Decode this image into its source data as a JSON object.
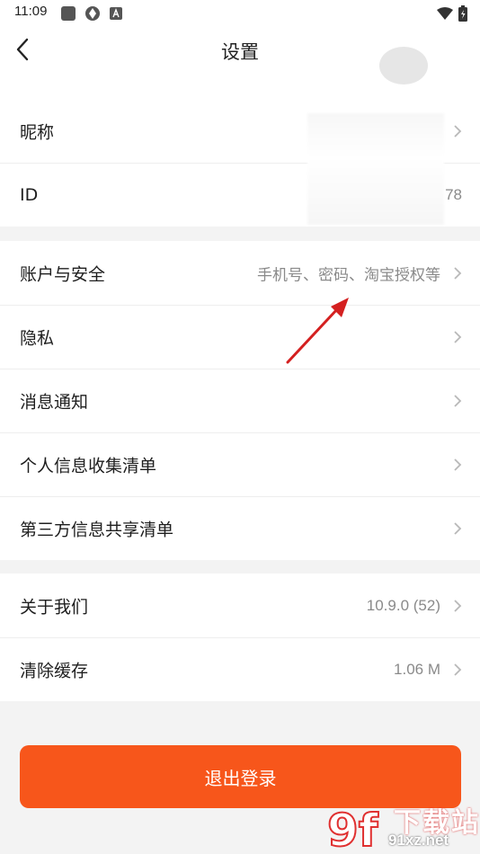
{
  "status_bar": {
    "time": "11:09"
  },
  "header": {
    "title": "设置"
  },
  "profile_rows": [
    {
      "label": "昵称",
      "value": ""
    },
    {
      "label": "ID",
      "value": "78"
    }
  ],
  "security_rows": [
    {
      "label": "账户与安全",
      "value": "手机号、密码、淘宝授权等"
    },
    {
      "label": "隐私",
      "value": ""
    },
    {
      "label": "消息通知",
      "value": ""
    },
    {
      "label": "个人信息收集清单",
      "value": ""
    },
    {
      "label": "第三方信息共享清单",
      "value": ""
    }
  ],
  "about_rows": [
    {
      "label": "关于我们",
      "value": "10.9.0 (52)"
    },
    {
      "label": "清除缓存",
      "value": "1.06 M"
    }
  ],
  "logout_label": "退出登录",
  "watermark": {
    "line1": "下载站",
    "line2": "91xz.net",
    "logo": "9f"
  },
  "colors": {
    "accent": "#f7561b",
    "annotation_arrow": "#d42020"
  }
}
